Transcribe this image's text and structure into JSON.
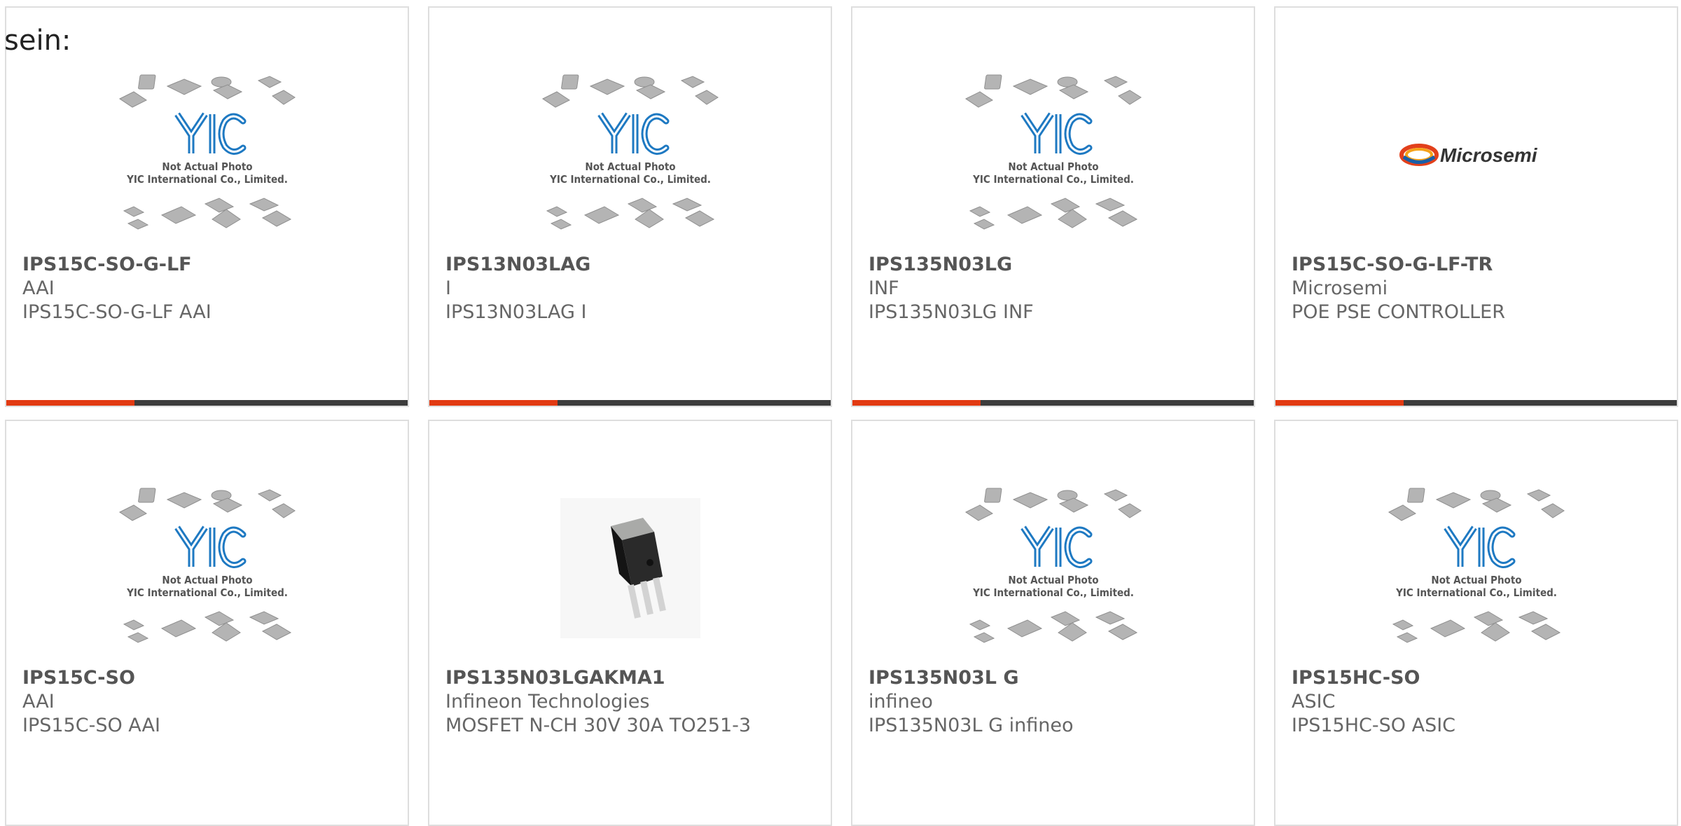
{
  "intro_text": "sein:",
  "placeholder_logo": {
    "brand": "YIC",
    "line1": "Not Actual Photo",
    "line2": "YIC International Co., Limited."
  },
  "microsemi_logo_text": "Microsemi",
  "colors": {
    "accent_red": "#e23a12",
    "bar_dark": "#3c3c3c",
    "border": "#dedede",
    "text": "#666666"
  },
  "products": [
    {
      "part": "IPS15C-SO-G-LF",
      "manufacturer": "AAI",
      "description": "IPS15C-SO-G-LF AAI",
      "image": "yic-placeholder"
    },
    {
      "part": "IPS13N03LAG",
      "manufacturer": "I",
      "description": "IPS13N03LAG I",
      "image": "yic-placeholder"
    },
    {
      "part": "IPS135N03LG",
      "manufacturer": "INF",
      "description": "IPS135N03LG INF",
      "image": "yic-placeholder"
    },
    {
      "part": "IPS15C-SO-G-LF-TR",
      "manufacturer": "Microsemi",
      "description": "POE PSE CONTROLLER",
      "image": "microsemi-logo"
    },
    {
      "part": "IPS15C-SO",
      "manufacturer": "AAI",
      "description": "IPS15C-SO AAI",
      "image": "yic-placeholder"
    },
    {
      "part": "IPS135N03LGAKMA1",
      "manufacturer": "Infineon Technologies",
      "description": "MOSFET N-CH 30V 30A TO251-3",
      "image": "to251-package-photo"
    },
    {
      "part": "IPS135N03L G",
      "manufacturer": "infineo",
      "description": "IPS135N03L G infineo",
      "image": "yic-placeholder"
    },
    {
      "part": "IPS15HC-SO",
      "manufacturer": "ASIC",
      "description": "IPS15HC-SO ASIC",
      "image": "yic-placeholder"
    }
  ]
}
